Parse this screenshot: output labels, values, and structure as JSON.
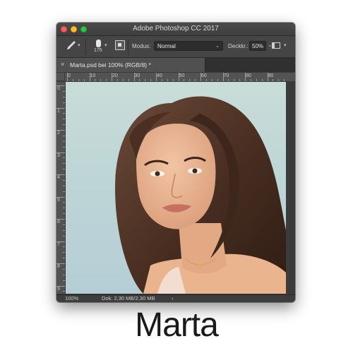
{
  "window": {
    "title": "Adobe Photoshop CC 2017"
  },
  "options_bar": {
    "brush_icon": "brush-icon",
    "brush_size": "175",
    "modus_label": "Modus:",
    "modus_value": "Normal",
    "deckkr_label": "Deckkr.:",
    "deckkr_value": "50%"
  },
  "document_tab": {
    "close": "×",
    "label": "Marta.psd bei 100% (RGB/8) *"
  },
  "ruler_top": [
    "0",
    "10",
    "20",
    "30",
    "40",
    "50",
    "60",
    "70",
    "80",
    "90"
  ],
  "ruler_left": [
    "0",
    "1",
    "2",
    "3",
    "4",
    "5",
    "6",
    "7",
    "8",
    "9"
  ],
  "status_bar": {
    "zoom": "100%",
    "doc_info": "Dok: 2,30 MB/2,30 MB",
    "arrow": "›"
  },
  "caption": "Marta",
  "colors": {
    "close": "#fc5f57",
    "minimize": "#fdbc2e",
    "maximize": "#28c840",
    "chrome": "#3b3b3b",
    "canvas_bg": "#c2d9d7",
    "hair": "#4a2f22"
  }
}
